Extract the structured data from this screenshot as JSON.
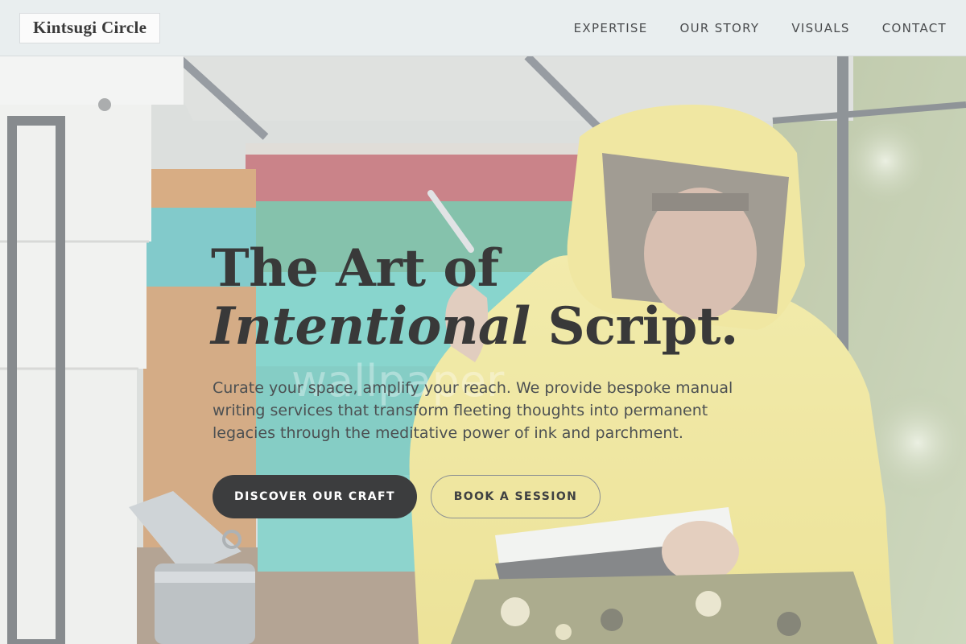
{
  "brand": {
    "name": "Kintsugi Circle"
  },
  "nav": {
    "items": [
      {
        "label": "EXPERTISE"
      },
      {
        "label": "OUR STORY"
      },
      {
        "label": "VISUALS"
      },
      {
        "label": "CONTACT"
      }
    ]
  },
  "hero": {
    "headline_line1": "The Art of",
    "headline_emphasis": "Intentional",
    "headline_line2_rest": " Script.",
    "lead": "Curate your space, amplify your reach. We provide bespoke manual writing services that transform fleeting thoughts into permanent legacies through the meditative power of ink and parchment.",
    "primary_cta": "DISCOVER OUR CRAFT",
    "secondary_cta": "BOOK A SESSION",
    "watermark": "wallpaper"
  },
  "colors": {
    "header_bg": "#e9eeef",
    "primary_button": "#3c3d3e",
    "headline_text": "#393939",
    "suit_yellow": "#f1e36a"
  }
}
